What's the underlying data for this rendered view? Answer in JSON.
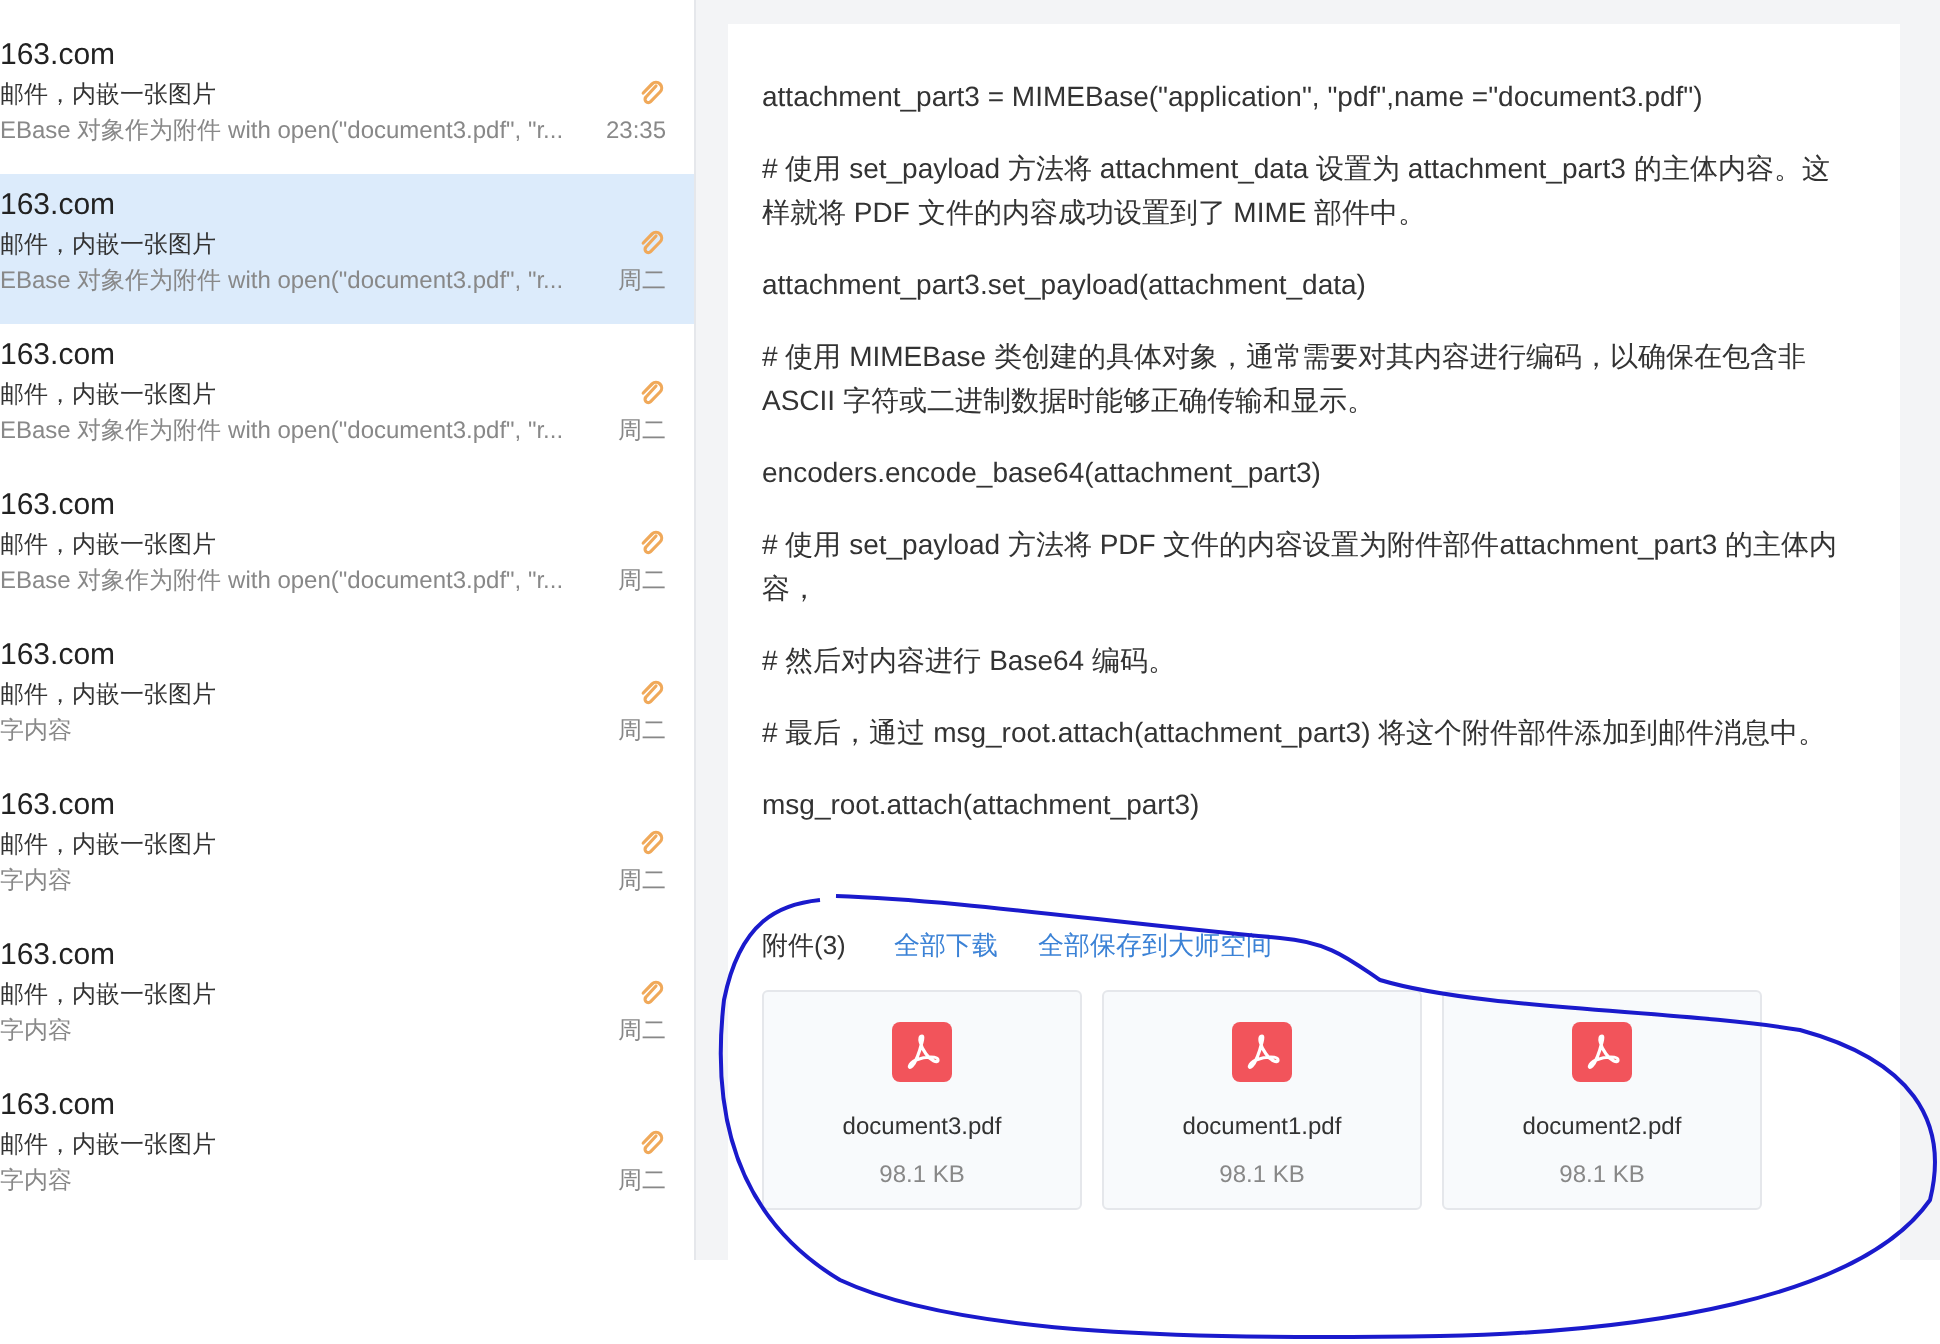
{
  "mail_list": [
    {
      "sender": "163.com",
      "subject": "邮件，内嵌一张图片",
      "preview": "EBase 对象作为附件 with open(\"document3.pdf\", \"r...",
      "time": "23:35",
      "attachment": true,
      "selected": false
    },
    {
      "sender": "163.com",
      "subject": "邮件，内嵌一张图片",
      "preview": "EBase 对象作为附件 with open(\"document3.pdf\", \"r...",
      "time": "周二",
      "attachment": true,
      "selected": true
    },
    {
      "sender": "163.com",
      "subject": "邮件，内嵌一张图片",
      "preview": "EBase 对象作为附件 with open(\"document3.pdf\", \"r...",
      "time": "周二",
      "attachment": true,
      "selected": false
    },
    {
      "sender": "163.com",
      "subject": "邮件，内嵌一张图片",
      "preview": "EBase 对象作为附件 with open(\"document3.pdf\", \"r...",
      "time": "周二",
      "attachment": true,
      "selected": false
    },
    {
      "sender": "163.com",
      "subject": "邮件，内嵌一张图片",
      "preview": "字内容",
      "time": "周二",
      "attachment": true,
      "selected": false
    },
    {
      "sender": "163.com",
      "subject": "邮件，内嵌一张图片",
      "preview": "字内容",
      "time": "周二",
      "attachment": true,
      "selected": false
    },
    {
      "sender": "163.com",
      "subject": "邮件，内嵌一张图片",
      "preview": "字内容",
      "time": "周二",
      "attachment": true,
      "selected": false
    },
    {
      "sender": "163.com",
      "subject": "邮件，内嵌一张图片",
      "preview": "字内容",
      "time": "周二",
      "attachment": true,
      "selected": false
    }
  ],
  "message_body": [
    "attachment_part3 = MIMEBase(\"application\", \"pdf\",name =\"document3.pdf\")",
    "# 使用 set_payload 方法将 attachment_data 设置为 attachment_part3 的主体内容。这样就将 PDF 文件的内容成功设置到了 MIME 部件中。",
    "attachment_part3.set_payload(attachment_data)",
    "# 使用 MIMEBase 类创建的具体对象，通常需要对其内容进行编码，以确保在包含非ASCII 字符或二进制数据时能够正确传输和显示。",
    "encoders.encode_base64(attachment_part3)",
    "# 使用 set_payload 方法将 PDF 文件的内容设置为附件部件attachment_part3 的主体内容，",
    "# 然后对内容进行 Base64 编码。",
    "# 最后，通过 msg_root.attach(attachment_part3) 将这个附件部件添加到邮件消息中。",
    "msg_root.attach(attachment_part3)"
  ],
  "attachments": {
    "label": "附件(3)",
    "actions": [
      "全部下载",
      "全部保存到大师空间"
    ],
    "files": [
      {
        "name": "document3.pdf",
        "size": "98.1 KB"
      },
      {
        "name": "document1.pdf",
        "size": "98.1 KB"
      },
      {
        "name": "document2.pdf",
        "size": "98.1 KB"
      }
    ]
  }
}
